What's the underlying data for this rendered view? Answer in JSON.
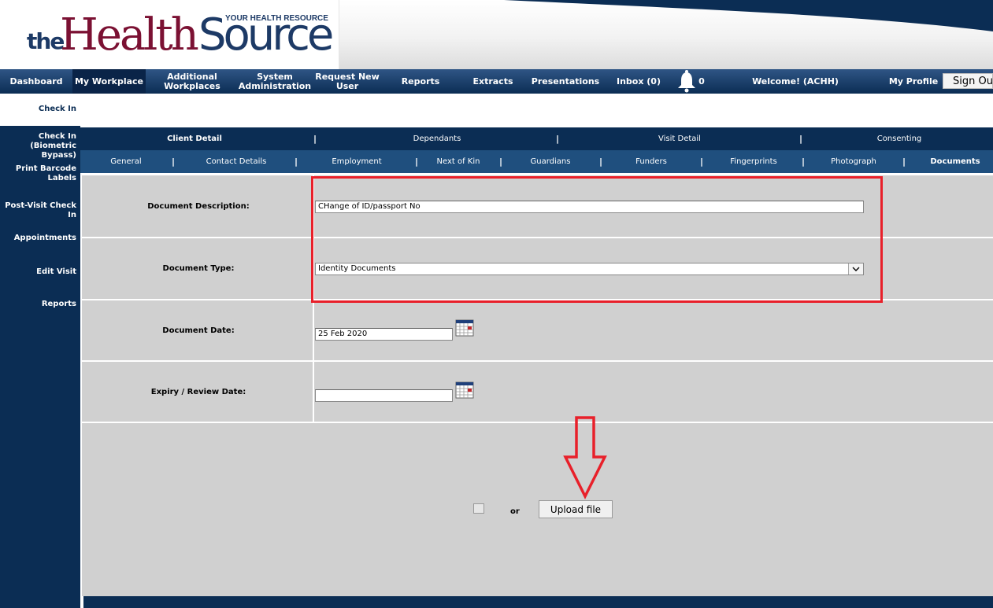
{
  "header": {
    "logo": {
      "the": "the",
      "health": "Health",
      "source": "Source",
      "tagline": "YOUR HEALTH RESOURCE"
    }
  },
  "topnav": {
    "items": [
      {
        "label": "Dashboard"
      },
      {
        "label": "My Workplace"
      },
      {
        "label": "Additional Workplaces"
      },
      {
        "label": "System Administration"
      },
      {
        "label": "Request New User"
      },
      {
        "label": "Reports"
      },
      {
        "label": "Extracts"
      },
      {
        "label": "Presentations"
      },
      {
        "label": "Inbox (0)"
      }
    ],
    "notification_count": "0",
    "welcome": "Welcome! (ACHH)",
    "my_profile": "My Profile",
    "sign_out": "Sign Out"
  },
  "sidebar": {
    "items": [
      {
        "label": "Check In"
      },
      {
        "label": "Check In (Biometric Bypass)"
      },
      {
        "label": "Print Barcode Labels"
      },
      {
        "label": "Post-Visit Check In"
      },
      {
        "label": "Appointments"
      },
      {
        "label": "Edit Visit"
      },
      {
        "label": "Reports"
      }
    ]
  },
  "tabs_primary": [
    "Client Detail",
    "Dependants",
    "Visit Detail",
    "Consenting"
  ],
  "tabs_secondary": [
    "General",
    "Contact Details",
    "Employment",
    "Next of Kin",
    "Guardians",
    "Funders",
    "Fingerprints",
    "Photograph",
    "Documents"
  ],
  "tab_separator": "|",
  "form": {
    "document_description": {
      "label": "Document Description:",
      "value": "CHange of ID/passport No"
    },
    "document_type": {
      "label": "Document Type:",
      "value": "Identity Documents"
    },
    "document_date": {
      "label": "Document Date:",
      "value": "25 Feb 2020"
    },
    "expiry_date": {
      "label": "Expiry / Review Date:",
      "value": ""
    },
    "or_text": "or",
    "upload_button": "Upload file"
  },
  "colors": {
    "navy": "#0b2d54",
    "nav_blue": "#1f4f7e",
    "brand_maroon": "#7b1133",
    "form_gray": "#d0d0d0",
    "annotation_red": "#e8202a"
  },
  "icons": [
    "bell-icon",
    "calendar-icon",
    "chevron-down-icon",
    "down-arrow-annotation"
  ]
}
